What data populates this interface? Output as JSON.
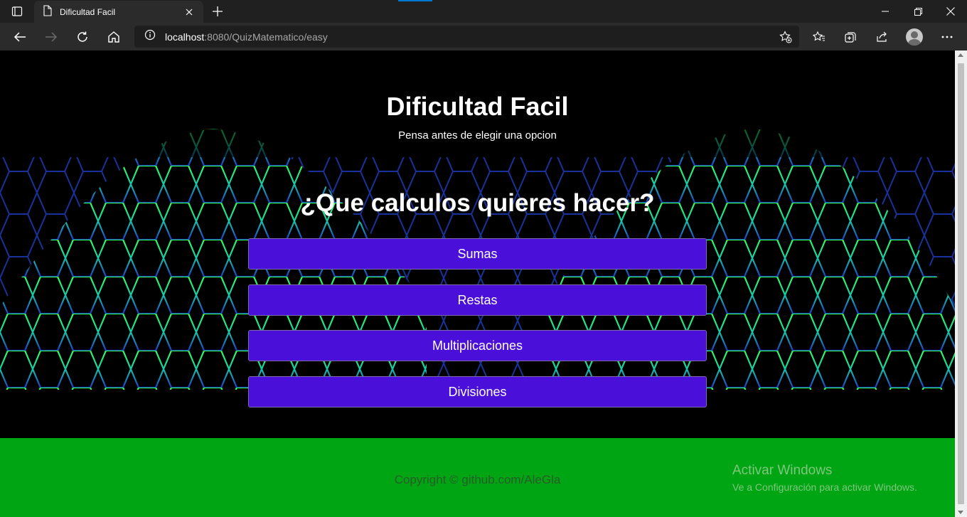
{
  "browser": {
    "tab_title": "Dificultad Facil",
    "address": {
      "host": "localhost",
      "rest": ":8080/QuizMatematico/easy"
    }
  },
  "page": {
    "title": "Dificultad Facil",
    "subtitle": "Pensa antes de elegir una opcion",
    "question": "¿Que calculos quieres hacer?",
    "options": [
      {
        "label": "Sumas"
      },
      {
        "label": "Restas"
      },
      {
        "label": "Multiplicaciones"
      },
      {
        "label": "Divisiones"
      }
    ]
  },
  "footer": {
    "copyright": "Copyright © github.com/AleGla"
  },
  "watermark": {
    "line1": "Activar Windows",
    "line2": "Ve a Configuración para activar Windows."
  },
  "colors": {
    "option_bg": "#4a0fd8",
    "footer_bg": "#00a513",
    "chrome_dark": "#202020"
  }
}
